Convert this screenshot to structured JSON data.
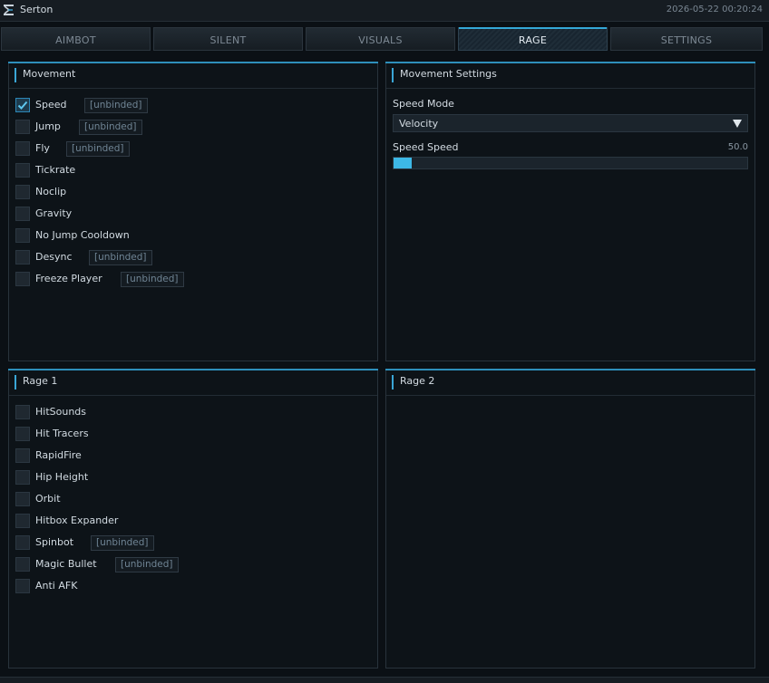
{
  "window": {
    "title": "Serton",
    "timestamp": "2026-05-22 00:20:24"
  },
  "tabs": [
    {
      "label": "AIMBOT",
      "active": false
    },
    {
      "label": "SILENT",
      "active": false
    },
    {
      "label": "VISUALS",
      "active": false
    },
    {
      "label": "RAGE",
      "active": true
    },
    {
      "label": "SETTINGS",
      "active": false
    }
  ],
  "movement": {
    "title": "Movement",
    "items": [
      {
        "label": "Speed",
        "checked": true,
        "keybind": "[unbinded]"
      },
      {
        "label": "Jump",
        "checked": false,
        "keybind": "[unbinded]"
      },
      {
        "label": "Fly",
        "checked": false,
        "keybind": "[unbinded]"
      },
      {
        "label": "Tickrate",
        "checked": false
      },
      {
        "label": "Noclip",
        "checked": false
      },
      {
        "label": "Gravity",
        "checked": false
      },
      {
        "label": "No Jump Cooldown",
        "checked": false
      },
      {
        "label": "Desync",
        "checked": false,
        "keybind": "[unbinded]"
      },
      {
        "label": "Freeze Player",
        "checked": false,
        "keybind": "[unbinded]"
      }
    ]
  },
  "movement_settings": {
    "title": "Movement Settings",
    "speed_mode_label": "Speed Mode",
    "speed_mode_value": "Velocity",
    "speed_speed_label": "Speed Speed",
    "speed_speed_value": "50.0",
    "speed_speed_fill_fraction": 0.05
  },
  "rage1": {
    "title": "Rage 1",
    "items": [
      {
        "label": "HitSounds",
        "checked": false
      },
      {
        "label": "Hit Tracers",
        "checked": false
      },
      {
        "label": "RapidFire",
        "checked": false
      },
      {
        "label": "Hip Height",
        "checked": false
      },
      {
        "label": "Orbit",
        "checked": false
      },
      {
        "label": "Hitbox Expander",
        "checked": false
      },
      {
        "label": "Spinbot",
        "checked": false,
        "keybind": "[unbinded]"
      },
      {
        "label": "Magic Bullet",
        "checked": false,
        "keybind": "[unbinded]"
      },
      {
        "label": "Anti AFK",
        "checked": false
      }
    ]
  },
  "rage2": {
    "title": "Rage 2"
  },
  "colors": {
    "accent": "#3db8e6",
    "background": "#0b1015",
    "panel": "#0d1318",
    "text": "#d2dbe2"
  }
}
